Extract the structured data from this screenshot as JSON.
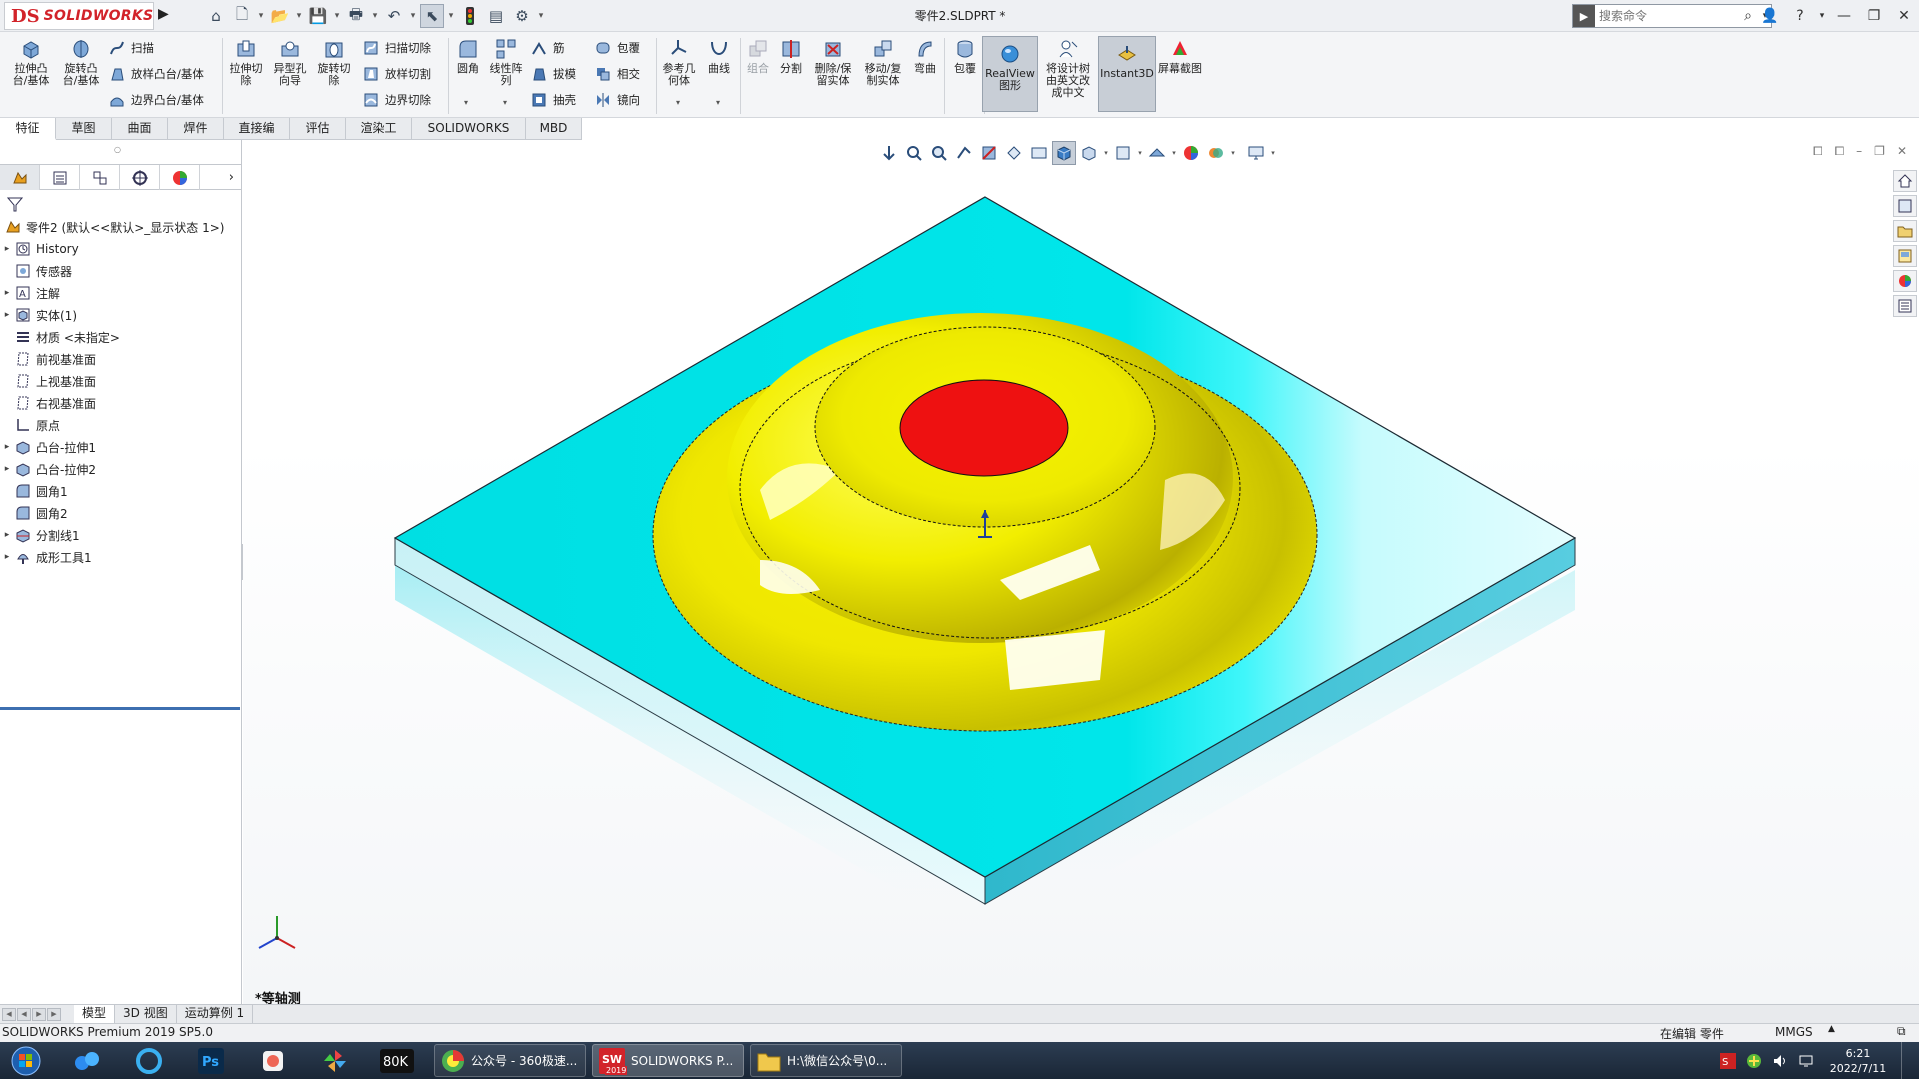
{
  "app": {
    "logo_mark": "DS",
    "logo_text": "SOLIDWORKS",
    "doc_title": "零件2.SLDPRT *"
  },
  "search": {
    "placeholder": "搜索命令"
  },
  "ribbon": {
    "extrude_boss": "拉伸凸台/基体",
    "revolve_boss": "旋转凸台/基体",
    "sweep": "扫描",
    "loft_boss": "放样凸台/基体",
    "boundary_boss": "边界凸台/基体",
    "extrude_cut": "拉伸切除",
    "hole_wizard": "异型孔向导",
    "revolve_cut": "旋转切除",
    "sweep_cut": "扫描切除",
    "loft_cut": "放样切割",
    "boundary_cut": "边界切除",
    "fillet": "圆角",
    "linear_pattern": "线性阵列",
    "rib": "筋",
    "draft": "拔模",
    "shell": "抽壳",
    "wrap": "包覆",
    "intersect": "相交",
    "mirror": "镜向",
    "ref_geometry": "参考几何体",
    "curves": "曲线",
    "combine": "组合",
    "split": "分割",
    "delete_keep": "删除/保留实体",
    "move_copy": "移动/复制实体",
    "flex": "弯曲",
    "wrap2": "包覆",
    "realview": "RealView图形",
    "translate_tree": "将设计树由英文改成中文",
    "instant3d": "Instant3D",
    "screenshot": "屏幕截图"
  },
  "tabs": [
    "特征",
    "草图",
    "曲面",
    "焊件",
    "直接编辑",
    "评估",
    "渲染工具",
    "SOLIDWORKS 插件",
    "MBD"
  ],
  "tree": {
    "root": "零件2 (默认<<默认>_显示状态 1>)",
    "items": [
      "History",
      "传感器",
      "注解",
      "实体(1)",
      "材质 <未指定>",
      "前视基准面",
      "上视基准面",
      "右视基准面",
      "原点",
      "凸台-拉伸1",
      "凸台-拉伸2",
      "圆角1",
      "圆角2",
      "分割线1",
      "成形工具1"
    ]
  },
  "viewport": {
    "view_name": "*等轴测"
  },
  "bottom_tabs": [
    "模型",
    "3D 视图",
    "运动算例 1"
  ],
  "status": {
    "product": "SOLIDWORKS Premium 2019 SP5.0",
    "editing": "在编辑 零件",
    "units": "MMGS",
    "units_arrow": "▲"
  },
  "taskbar": {
    "app1": "公众号 - 360极速...",
    "app2": "SOLIDWORKS P...",
    "app3": "H:\\微信公众号\\0...",
    "sw_badge": "2019",
    "time": "6:21",
    "date": "2022/7/11"
  },
  "colors": {
    "plate_top": "#00e0e4",
    "dome": "#f2f000",
    "red_cap": "#ee1111",
    "accent_red": "#d2232a"
  }
}
